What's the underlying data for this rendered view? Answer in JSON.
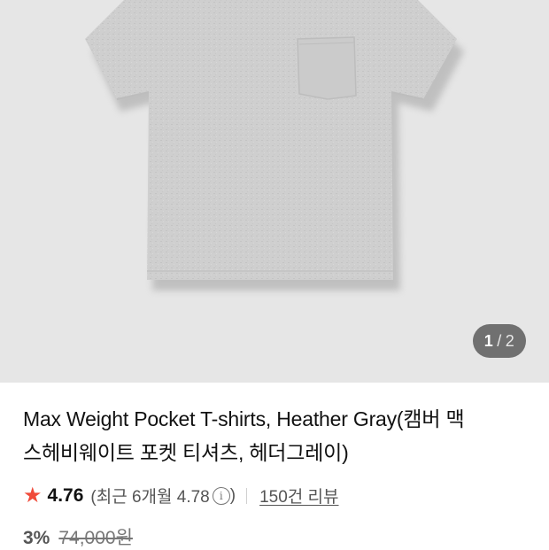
{
  "gallery": {
    "current_page": "1",
    "separator": "/",
    "total_pages": "2"
  },
  "product": {
    "title_line1": "Max Weight Pocket T-shirts, Heather Gray(캠버 맥",
    "title_line2": "스헤비웨이트 포켓 티셔츠, 헤더그레이)"
  },
  "rating": {
    "star_icon": "star-icon",
    "score": "4.76",
    "recent_label": "(최근 6개월 4.78",
    "recent_close": ")",
    "info_glyph": "i",
    "review_count": "150건 리뷰"
  },
  "price": {
    "discount": "3%",
    "original": "74,000원"
  },
  "colors": {
    "accent_star": "#f04b3a",
    "gallery_bg": "#e6e6e6"
  }
}
